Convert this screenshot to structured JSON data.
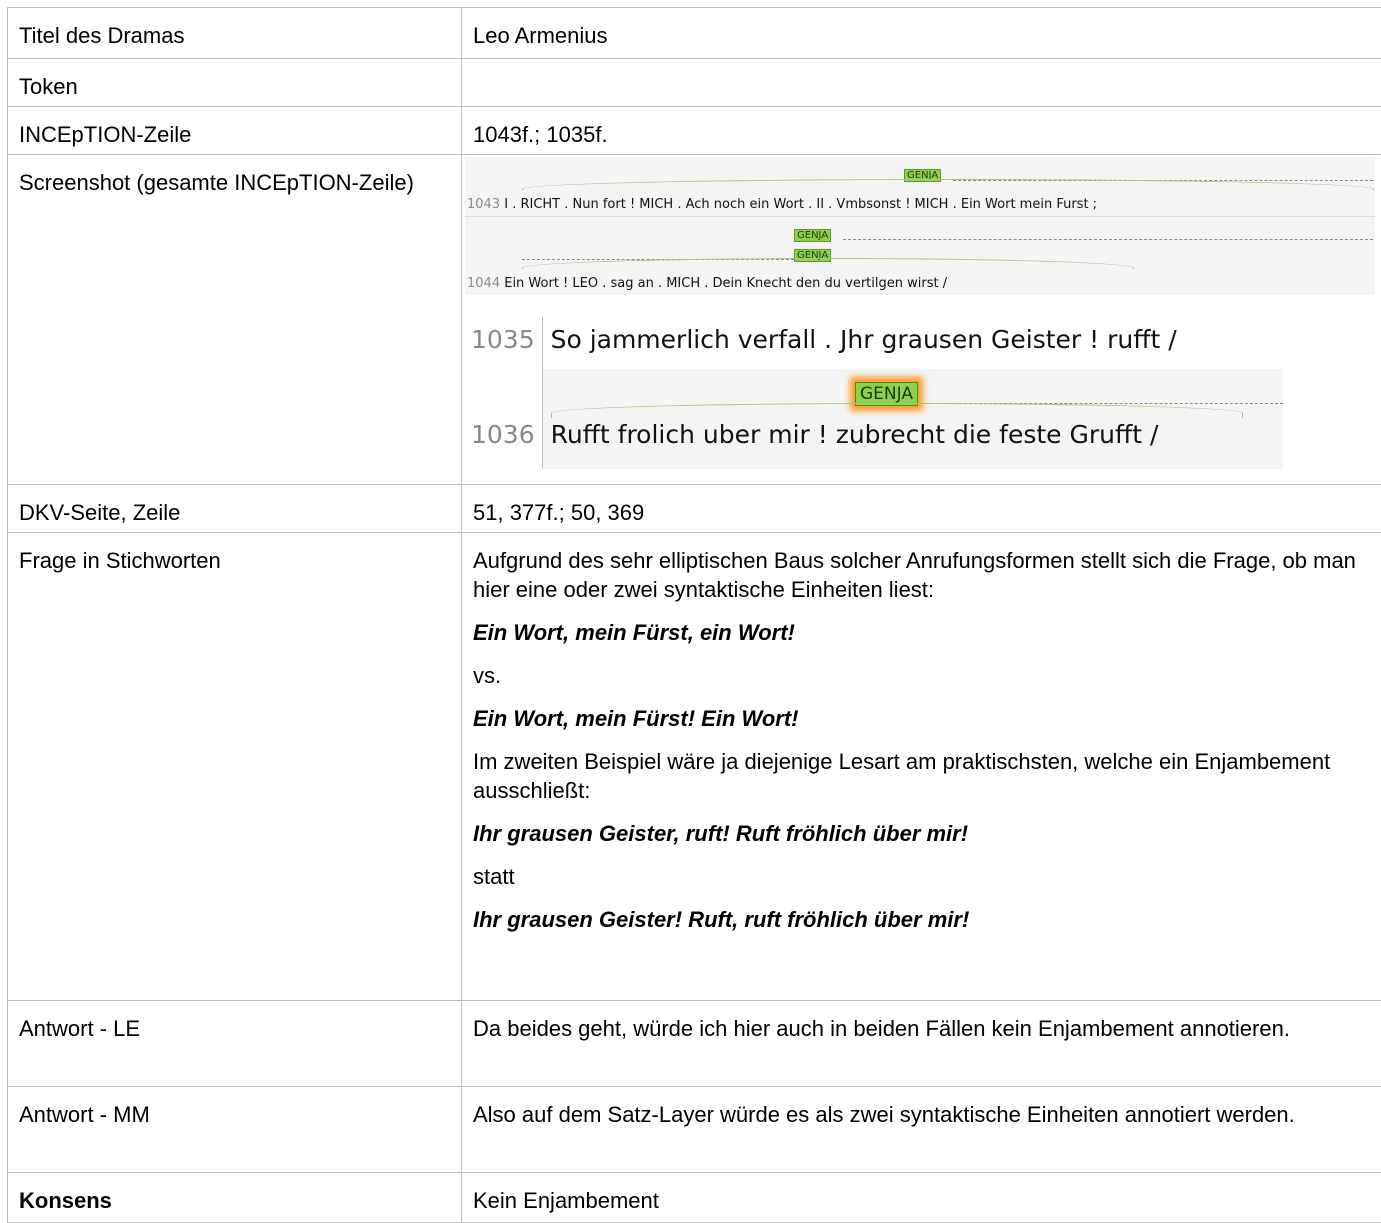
{
  "rows": {
    "titel": {
      "label": "Titel des Dramas",
      "value": "Leo Armenius"
    },
    "token": {
      "label": "Token",
      "value": ""
    },
    "zeile": {
      "label": "INCEpTION-Zeile",
      "value": "1043f.; 1035f."
    },
    "screenshot": {
      "label": "Screenshot (gesamte INCEpTION-Zeile)"
    },
    "dkv": {
      "label": "DKV-Seite, Zeile",
      "value": "51, 377f.; 50, 369"
    },
    "frage": {
      "label": "Frage in Stichworten",
      "p1": "Aufgrund des sehr elliptischen Baus solcher Anrufungsformen stellt sich die Frage, ob man hier eine oder zwei syntaktische Einheiten liest:",
      "ex1": "Ein Wort, mein Fürst, ein Wort!",
      "vs": "vs.",
      "ex2": "Ein Wort, mein Fürst! Ein Wort!",
      "p2": "Im zweiten Beispiel wäre ja diejenige Lesart am praktischsten, welche ein Enjambement ausschließt:",
      "ex3": "Ihr grausen Geister, ruft! Ruft fröhlich über mir!",
      "statt": "statt",
      "ex4": "Ihr grausen Geister! Ruft, ruft fröhlich über mir!"
    },
    "le": {
      "label": "Antwort - LE",
      "value": "Da beides geht, würde ich hier auch in beiden Fällen kein Enjambement annotieren."
    },
    "mm": {
      "label": "Antwort - MM",
      "value": "Also auf dem Satz-Layer würde es als zwei syntaktische Einheiten annotiert werden."
    },
    "konsens": {
      "label": "Konsens",
      "value": "Kein Enjambement"
    }
  },
  "screenshot": {
    "tag": "GENJA",
    "line1_no": "1043",
    "line1_text": "I . RICHT . Nun fort ! MICH . Ach noch ein Wort . II . Vmbsonst ! MICH . Ein Wort mein Furst ;",
    "line2_no": "1044",
    "line2_text": "Ein Wort ! LEO . sag an . MICH . Dein Knecht den du vertilgen wirst /",
    "line3_no": "1035",
    "line3_text": "So jammerlich verfall . Jhr grausen Geister ! rufft /",
    "line4_no": "1036",
    "line4_text": "Rufft frolich uber mir ! zubrecht die feste Grufft /"
  }
}
